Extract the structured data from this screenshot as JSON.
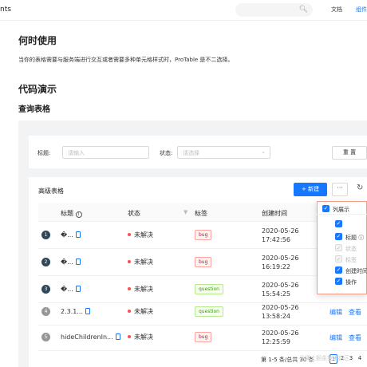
{
  "header": {
    "logo": "nts",
    "search_icon": "search-icon",
    "nav": [
      "文档",
      "组件"
    ]
  },
  "content": {
    "section1_title": "何时使用",
    "section1_text": "当你的表格需要与服务端进行交互或者需要多种单元格样式时，ProTable 是不二选择。",
    "section2_title": "代码演示",
    "demo_title": "查询表格"
  },
  "search_form": {
    "title_label": "标题",
    "title_placeholder": "请输入",
    "status_label": "状态",
    "status_placeholder": "请选择",
    "reset_label": "重 置"
  },
  "table": {
    "title": "高级表格",
    "new_button": "+ 新建",
    "more_button": "···",
    "columns": [
      "标题",
      "状态",
      "标签",
      "创建时间"
    ],
    "rows": [
      {
        "index": "1",
        "title": "�...",
        "status": "未解决",
        "tag": "bug",
        "date": "2020-05-26",
        "time": "17:42:56",
        "index_color": "#314659"
      },
      {
        "index": "2",
        "title": "�...",
        "status": "未解决",
        "tag": "bug",
        "date": "2020-05-26",
        "time": "16:19:22",
        "index_color": "#314659"
      },
      {
        "index": "3",
        "title": "�...",
        "status": "未解决",
        "tag": "question",
        "date": "2020-05-26",
        "time": "15:54:25",
        "index_color": "#314659"
      },
      {
        "index": "4",
        "title": "2.3.1...",
        "status": "未解决",
        "tag": "question",
        "date": "2020-05-26",
        "time": "13:58:24",
        "index_color": "#979797"
      },
      {
        "index": "5",
        "title": "hideChildrenIn...",
        "status": "未解决",
        "tag": "bug",
        "date": "2020-05-26",
        "time": "12:25:59",
        "index_color": "#979797"
      }
    ],
    "actions": [
      "编辑",
      "查看"
    ],
    "pagination": {
      "summary": "第 1-5 条/总共 30 条",
      "pages": [
        "1",
        "2",
        "3",
        "4"
      ]
    }
  },
  "column_settings": {
    "header": "列展示",
    "items": [
      {
        "label": "",
        "checked": true,
        "disabled": false
      },
      {
        "label": "标题 ⓘ",
        "checked": true,
        "disabled": false
      },
      {
        "label": "状态",
        "checked": true,
        "disabled": true
      },
      {
        "label": "标签",
        "checked": true,
        "disabled": true
      },
      {
        "label": "创建时间",
        "checked": true,
        "disabled": false
      },
      {
        "label": "操作",
        "checked": true,
        "disabled": false
      }
    ]
  },
  "watermark": "@稀土掘金技术社区",
  "colors": {
    "primary": "#1677ff",
    "error_dot": "#ff4d4f",
    "bug_tag": "#cf1322",
    "question_tag": "#389e0d",
    "highlight_border": "#f3a08a"
  }
}
